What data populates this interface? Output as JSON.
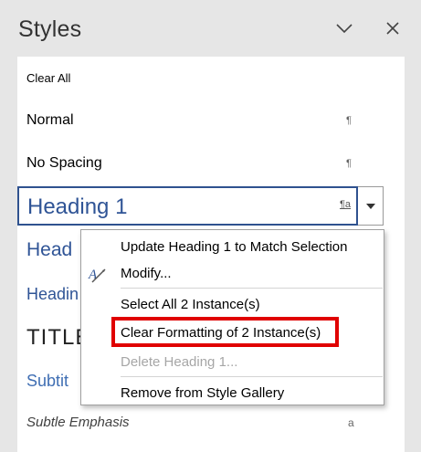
{
  "pane": {
    "title": "Styles"
  },
  "styles_list": {
    "clear_all": "Clear All",
    "normal": "Normal",
    "no_spacing": "No Spacing",
    "heading1": "Heading 1",
    "heading2": "Head",
    "heading3": "Headin",
    "title": "TITLE",
    "subtitle": "Subtit",
    "subtle_emphasis": "Subtle Emphasis",
    "para_mark": "¶",
    "linked_mark": "¶a",
    "char_mark": "a"
  },
  "context_menu": {
    "items": [
      {
        "label": "Update Heading 1 to Match Selection",
        "enabled": true
      },
      {
        "label": "Modify...",
        "enabled": true
      },
      {
        "label": "Select All 2 Instance(s)",
        "enabled": true
      },
      {
        "label": "Clear Formatting of 2 Instance(s)",
        "enabled": true
      },
      {
        "label": "Delete Heading 1...",
        "enabled": false
      },
      {
        "label": "Remove from Style Gallery",
        "enabled": true
      }
    ]
  },
  "colors": {
    "heading_blue": "#2f5496",
    "highlight_red": "#e00000",
    "pane_bg": "#e6e6e6"
  }
}
